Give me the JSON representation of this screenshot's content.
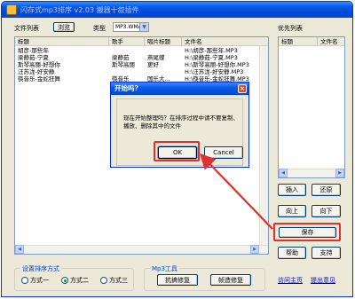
{
  "window": {
    "title": "闪存式mp3排序 v2.03 搬器十叙插件"
  },
  "toolbar": {
    "file_list_label": "文件列表",
    "browse_label": "浏览",
    "type_label": "类型",
    "type_value": "MP3.WMA",
    "priority_list_label": "优先列表"
  },
  "file_table": {
    "columns": [
      "标题",
      "歌手",
      "唱片标题",
      "文件名"
    ],
    "rows": [
      [
        "胡彦-那些年",
        "",
        "",
        "H:\\胡彦-那些年.MP3"
      ],
      [
        "梁静茹-宁夏",
        "梁静茹",
        "燕尾蝶",
        "H:\\梁静茹-宁夏.MP3"
      ],
      [
        "斯琴高丽-好想你",
        "斯琴高丽",
        "更好",
        "H:\\斯琴高丽-好想你.MP3"
      ],
      [
        "汪苏泷-好安静",
        "",
        "",
        "H:\\汪苏泷-好安静.MP3"
      ],
      [
        "筷音乐-金蛇狂舞",
        "筷音乐",
        "国乐大...",
        "H:\\筷音乐-金蛇狂舞.MP3"
      ]
    ]
  },
  "priority_table": {
    "columns": [
      "标题",
      "文件名"
    ]
  },
  "buttons": {
    "insert": "插入",
    "restore": "还原",
    "up": "向上",
    "down": "向下",
    "save": "保存",
    "help": "帮助",
    "support": "支持",
    "fix_swap": "抗搞修复",
    "fix_frame": "帧造修复"
  },
  "sort_group": {
    "title": "设置排序方式",
    "options": [
      "方式一",
      "方式二",
      "方式三"
    ],
    "selected_index": 1
  },
  "mp3_group": {
    "title": "Mp3工具"
  },
  "links": {
    "home": "访问主页",
    "feedback": "提出意见"
  },
  "dialog": {
    "title": "开始吗?",
    "message": "现在开始整理吗？在排序过程中请不要复制、播放、删除其中的文件",
    "ok_label": "OK",
    "cancel_label": "Cancel",
    "close_glyph": "×"
  },
  "colors": {
    "highlight": "#e03030",
    "title_bar": "#0046d5"
  }
}
